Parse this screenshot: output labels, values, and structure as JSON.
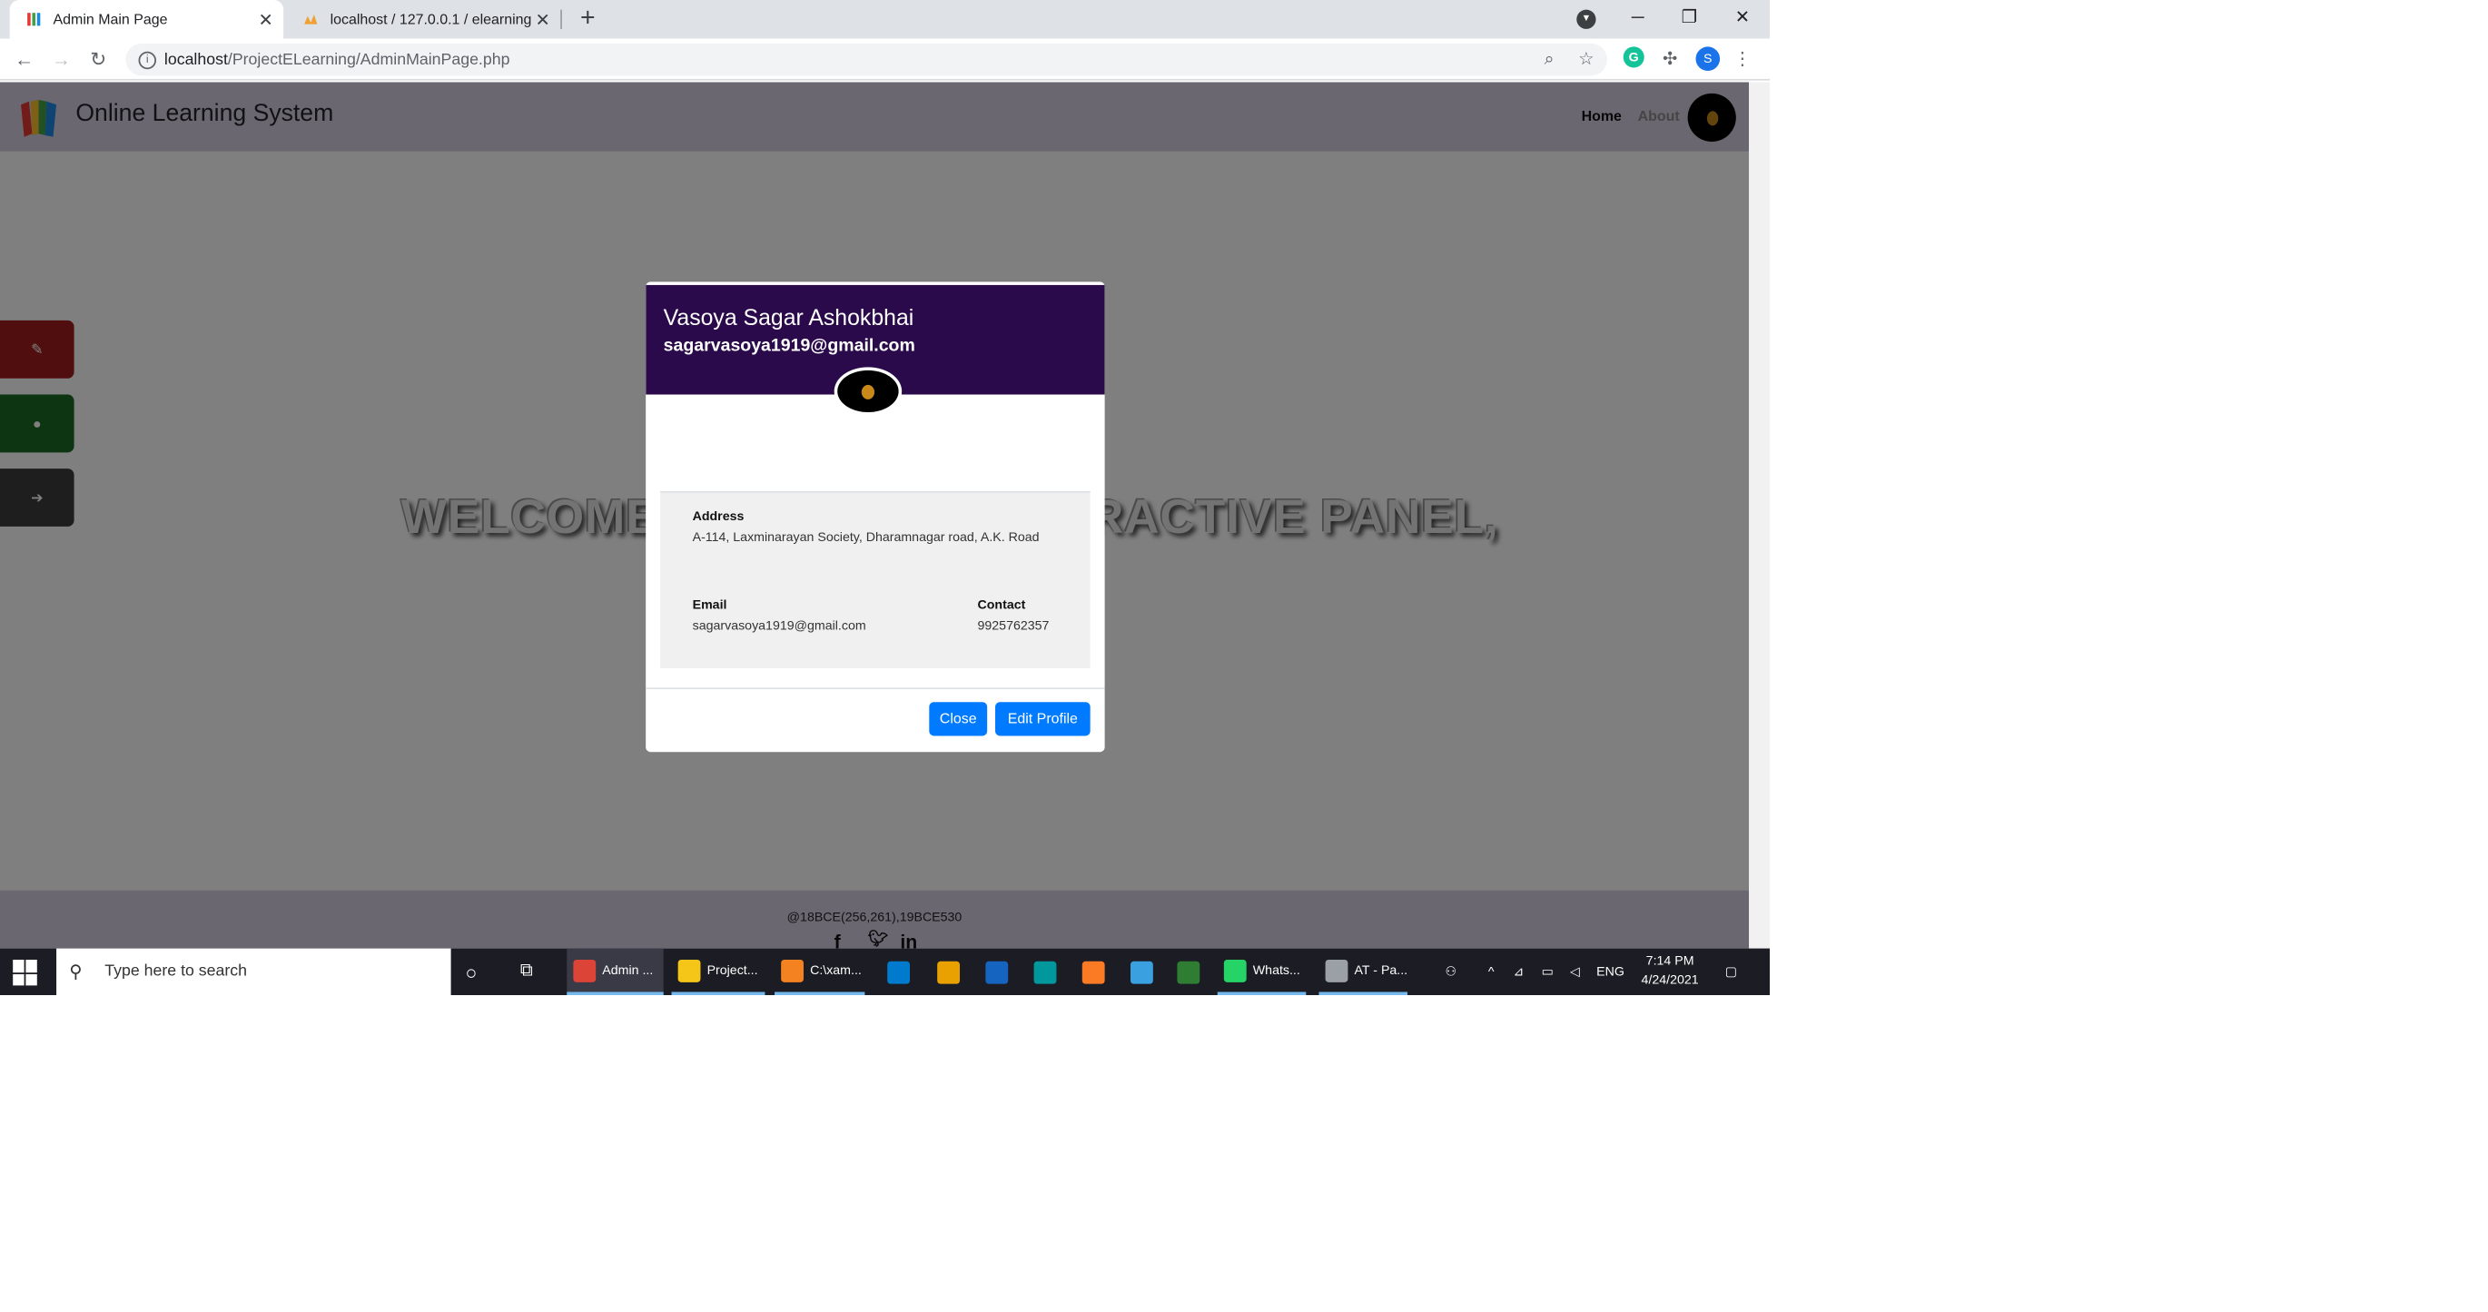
{
  "browser": {
    "tabs": [
      {
        "title": "Admin Main Page",
        "active": true
      },
      {
        "title": "localhost / 127.0.0.1 / elearning /",
        "active": false
      }
    ],
    "new_tab": "+",
    "url_host": "localhost",
    "url_path": "/ProjectELearning/AdminMainPage.php",
    "profile_initial": "S"
  },
  "app": {
    "brand": "Online Learning System",
    "nav": {
      "home": "Home",
      "about": "About"
    },
    "welcome": "WELCOME TO ADMIN'S INTERACTIVE PANEL,",
    "sidebar": [
      {
        "name": "edit",
        "color": "#a11d1d",
        "glyph": "✎"
      },
      {
        "name": "user",
        "color": "#1d6b22",
        "glyph": "●"
      },
      {
        "name": "logout",
        "color": "#3d3d3d",
        "glyph": "➔"
      }
    ],
    "footer": {
      "text": "@18BCE(256,261),19BCE530",
      "social": [
        "f",
        "t",
        "in"
      ]
    }
  },
  "modal": {
    "name": "Vasoya Sagar Ashokbhai",
    "email_header": "sagarvasoya1919@gmail.com",
    "address_label": "Address",
    "address": "A-114, Laxminarayan Society, Dharamnagar road, A.K. Road",
    "email_label": "Email",
    "email": "sagarvasoya1919@gmail.com",
    "contact_label": "Contact",
    "contact": "9925762357",
    "close_label": "Close",
    "edit_label": "Edit Profile",
    "button_color": "#007bff",
    "header_color": "#2a0a4a"
  },
  "taskbar": {
    "search_placeholder": "Type here to search",
    "items": [
      {
        "label": "Admin ...",
        "color": "#db4437",
        "running": true,
        "active": true
      },
      {
        "label": "Project...",
        "color": "#f5c518",
        "running": true
      },
      {
        "label": "C:\\xam...",
        "color": "#f58220",
        "running": true
      },
      {
        "label": "",
        "color": "#007acc"
      },
      {
        "label": "",
        "color": "#e8a100"
      },
      {
        "label": "",
        "color": "#1565c0"
      },
      {
        "label": "",
        "color": "#00979d"
      },
      {
        "label": "",
        "color": "#fb7a24"
      },
      {
        "label": "",
        "color": "#3aa0e0"
      },
      {
        "label": "",
        "color": "#2e7d32"
      },
      {
        "label": "Whats...",
        "color": "#25d366",
        "running": true
      },
      {
        "label": "AT - Pa...",
        "color": "#9aa0a6",
        "running": true
      }
    ],
    "lang": "ENG",
    "time": "7:14 PM",
    "date": "4/24/2021"
  }
}
